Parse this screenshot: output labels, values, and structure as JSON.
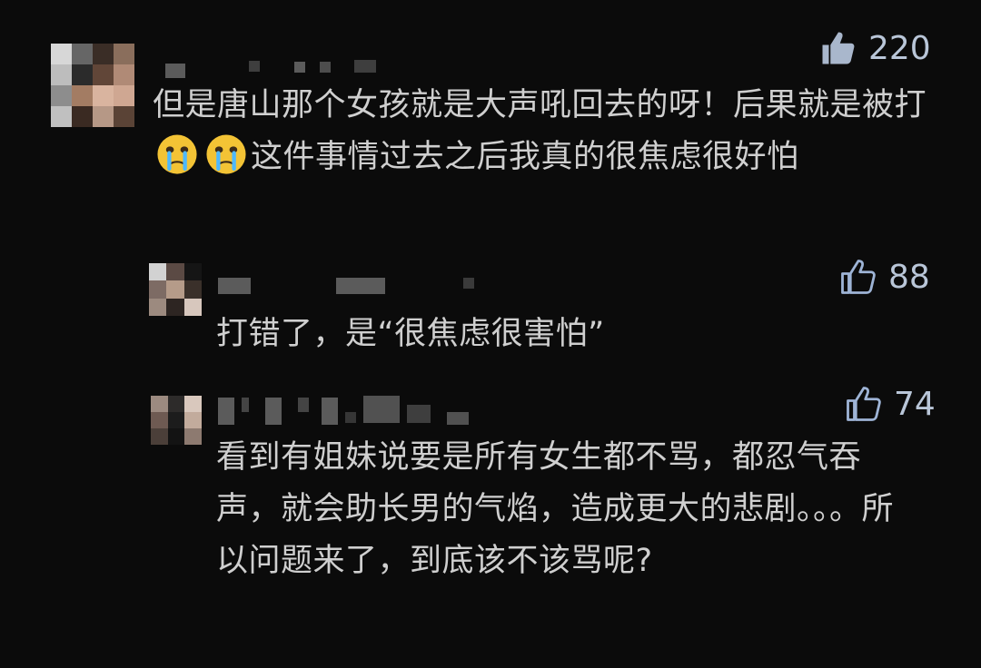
{
  "comments": [
    {
      "likes": "220",
      "text_before_emoji": "但是唐山那个女孩就是大声吼回去的呀！后果就是被打",
      "text_after_emoji": "这件事情过去之后我真的很焦虑很好怕",
      "emoji": [
        "crying-face",
        "crying-face"
      ]
    },
    {
      "likes": "88",
      "text": "打错了，是“很焦虑很害怕”"
    },
    {
      "likes": "74",
      "text": "看到有姐妹说要是所有女生都不骂，都忍气吞声，就会助长男的气焰，造成更大的悲剧。。。所以问题来了，到底该不该骂呢?"
    }
  ],
  "colors": {
    "background": "#0b0b0b",
    "text": "#cfcfcf",
    "like_main": "#a9b7cc",
    "like_reply": "#9eb4d6",
    "blurred_name": "#6a6a6a"
  }
}
